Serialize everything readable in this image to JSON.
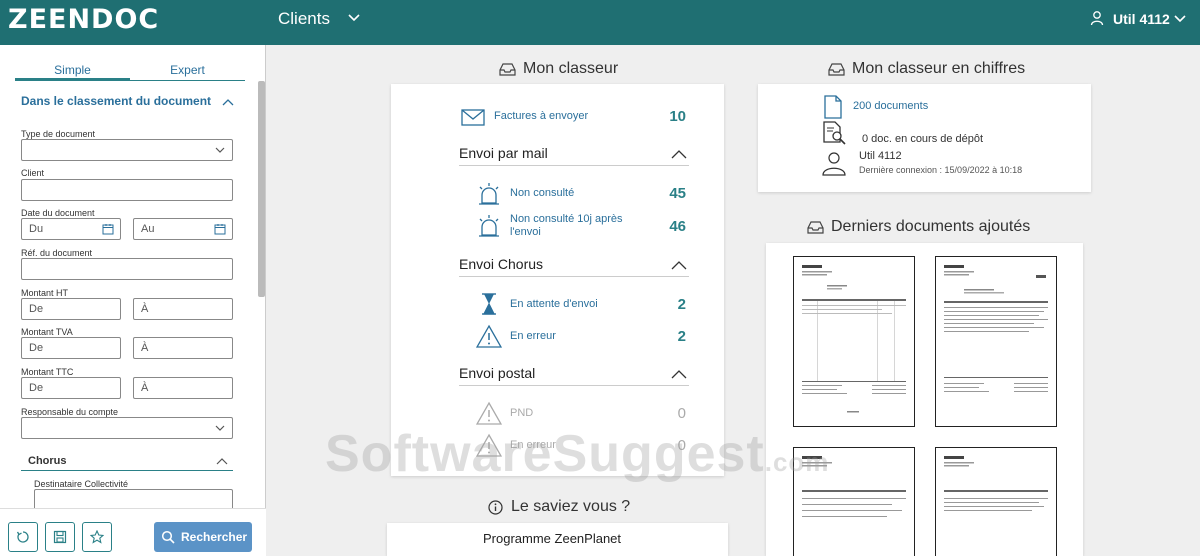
{
  "header": {
    "logo": "ZEENDOC",
    "section": "Clients",
    "user": "Util 4112"
  },
  "sidebar": {
    "tabs": [
      "Simple",
      "Expert"
    ],
    "section_title": "Dans le classement du document",
    "fields": {
      "type_document": "Type de document",
      "client": "Client",
      "date_document": "Date du document",
      "date_from_placeholder": "Du",
      "date_to_placeholder": "Au",
      "ref_document": "Réf. du document",
      "montant_ht": "Montant HT",
      "montant_tva": "Montant TVA",
      "montant_ttc": "Montant TTC",
      "from_placeholder": "De",
      "to_placeholder": "À",
      "responsable": "Responsable du compte"
    },
    "chorus": {
      "title": "Chorus",
      "destinataire": "Destinataire Collectivité"
    },
    "search_button": "Rechercher"
  },
  "classeur": {
    "title": "Mon classeur",
    "factures": {
      "label": "Factures à envoyer",
      "count": "10"
    },
    "mail": {
      "title": "Envoi par mail",
      "non_consulte": {
        "label": "Non consulté",
        "count": "45"
      },
      "non_consulte_10j": {
        "label_line1": "Non consulté 10j après",
        "label_line2": "l'envoi",
        "count": "46"
      }
    },
    "chorus": {
      "title": "Envoi Chorus",
      "attente": {
        "label": "En attente d'envoi",
        "count": "2"
      },
      "erreur": {
        "label": "En erreur",
        "count": "2"
      }
    },
    "postal": {
      "title": "Envoi postal",
      "pnd": {
        "label": "PND",
        "count": "0"
      },
      "erreur": {
        "label": "En erreur",
        "count": "0"
      }
    }
  },
  "chiffres": {
    "title": "Mon classeur en chiffres",
    "documents": "200 documents",
    "depot": "0 doc. en cours de dépôt",
    "user": "Util 4112",
    "last_login": "Dernière connexion : 15/09/2022 à 10:18"
  },
  "derniers": {
    "title": "Derniers documents ajoutés"
  },
  "saviez": {
    "title": "Le saviez vous ?",
    "programme": "Programme ZeenPlanet"
  },
  "watermark": {
    "text": "SoftwareSuggest",
    "suffix": ".com"
  },
  "colors": {
    "header": "#1f6f72",
    "accent": "#2a8087",
    "link": "#2a6f9b",
    "button": "#5b93c7"
  }
}
